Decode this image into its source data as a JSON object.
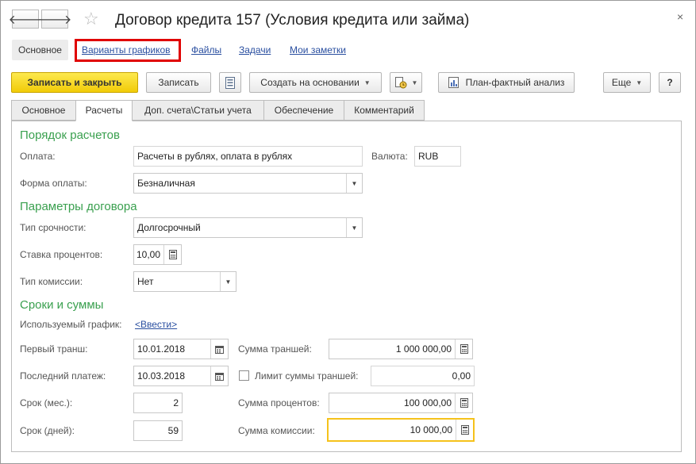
{
  "window": {
    "title": "Договор кредита 157 (Условия кредита или займа)",
    "close_glyph": "×",
    "back_glyph": "🡐",
    "forward_glyph": "🡒"
  },
  "sections": {
    "main": "Основное",
    "schedules": "Варианты графиков",
    "files": "Файлы",
    "tasks": "Задачи",
    "notes": "Мои заметки"
  },
  "toolbar": {
    "save_close": "Записать и закрыть",
    "save": "Записать",
    "create_based": "Создать на основании",
    "plan_fact": "План-фактный анализ",
    "more": "Еще",
    "help": "?"
  },
  "tabs": [
    "Основное",
    "Расчеты",
    "Доп. счета\\Статьи учета",
    "Обеспечение",
    "Комментарий"
  ],
  "form": {
    "group_calc": "Порядок расчетов",
    "payment_label": "Оплата:",
    "payment_value": "Расчеты в рублях, оплата в рублях",
    "currency_label": "Валюта:",
    "currency_value": "RUB",
    "payment_form_label": "Форма оплаты:",
    "payment_form_value": "Безналичная",
    "group_params": "Параметры договора",
    "term_type_label": "Тип срочности:",
    "term_type_value": "Долгосрочный",
    "rate_label": "Ставка процентов:",
    "rate_value": "10,00",
    "commission_type_label": "Тип комиссии:",
    "commission_type_value": "Нет",
    "group_terms": "Сроки и суммы",
    "schedule_label": "Используемый график:",
    "schedule_link": "<Ввести>",
    "first_tranche_label": "Первый транш:",
    "first_tranche_value": "10.01.2018",
    "last_payment_label": "Последний платеж:",
    "last_payment_value": "10.03.2018",
    "term_months_label": "Срок (мес.):",
    "term_months_value": "2",
    "term_days_label": "Срок (дней):",
    "term_days_value": "59",
    "tranches_sum_label": "Сумма траншей:",
    "tranches_sum_value": "1 000 000,00",
    "tranches_limit_label": "Лимит суммы траншей:",
    "tranches_limit_value": "0,00",
    "tranches_limit_checked": false,
    "interest_sum_label": "Сумма процентов:",
    "interest_sum_value": "100 000,00",
    "commission_sum_label": "Сумма комиссии:",
    "commission_sum_value": "10 000,00"
  }
}
